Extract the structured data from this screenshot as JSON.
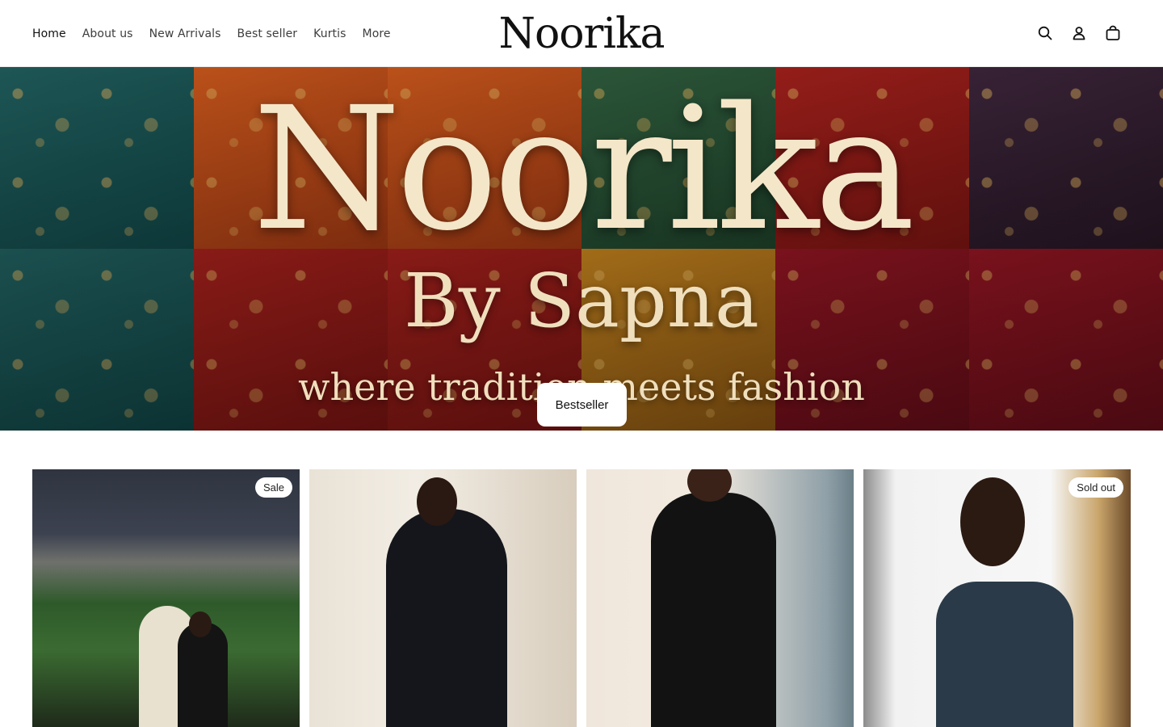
{
  "brand": {
    "logo": "Noorika"
  },
  "nav": {
    "items": [
      {
        "label": "Home",
        "active": true
      },
      {
        "label": "About us",
        "active": false
      },
      {
        "label": "New Arrivals",
        "active": false
      },
      {
        "label": "Best seller",
        "active": false
      },
      {
        "label": "Kurtis",
        "active": false
      },
      {
        "label": "More",
        "active": false
      }
    ]
  },
  "header_icons": [
    "search-icon",
    "account-icon",
    "cart-icon"
  ],
  "hero": {
    "title": "Noorika",
    "subtitle": "By Sapna",
    "tagline": "where tradition meets fashion",
    "button_label": "Bestseller"
  },
  "products": [
    {
      "badge": "Sale"
    },
    {
      "badge": ""
    },
    {
      "badge": ""
    },
    {
      "badge": "Sold out"
    }
  ],
  "colors": {
    "text": "#1a1a1a",
    "hero_text": "#f4e6c8",
    "background": "#ffffff"
  }
}
